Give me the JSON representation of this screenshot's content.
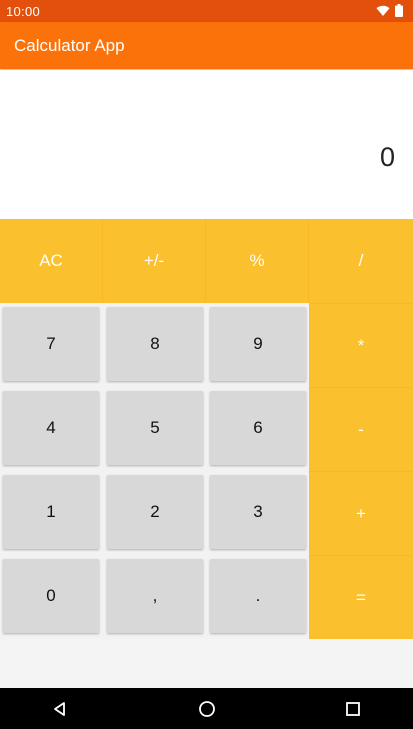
{
  "status": {
    "time": "10:00"
  },
  "app": {
    "title": "Calculator App"
  },
  "display": {
    "value": "0"
  },
  "keys": {
    "ac": "AC",
    "sign": "+/-",
    "percent": "%",
    "divide": "/",
    "multiply": "*",
    "minus": "-",
    "plus": "+",
    "equals": "=",
    "seven": "7",
    "eight": "8",
    "nine": "9",
    "four": "4",
    "five": "5",
    "six": "6",
    "one": "1",
    "two": "2",
    "three": "3",
    "zero": "0",
    "comma": ",",
    "dot": "."
  },
  "colors": {
    "status_bar": "#e2500c",
    "app_bar": "#fb720a",
    "operator_keys": "#fbc02d",
    "number_keys": "#d7d8d7"
  },
  "icons": [
    "wifi-icon",
    "battery-icon",
    "back-icon",
    "home-icon",
    "recents-icon"
  ]
}
